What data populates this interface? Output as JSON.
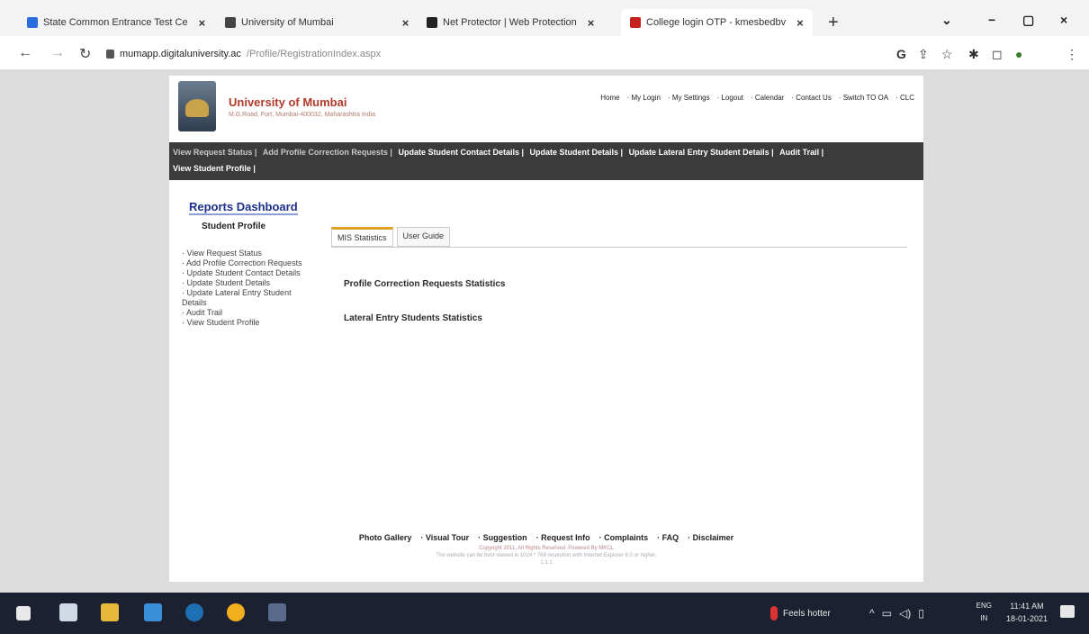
{
  "browser": {
    "tabs": [
      {
        "label": "State Common Entrance Test Ce",
        "color": "#2d6cdf"
      },
      {
        "label": "University of Mumbai",
        "color": "#444444"
      },
      {
        "label": "Net Protector | Web Protection",
        "color": "#222222"
      },
      {
        "label": "College login OTP - kmesbedbv",
        "color": "#c5221f"
      }
    ],
    "url_host": "mumapp.digitaluniversity.ac",
    "url_path": "/Profile/RegistrationIndex.aspx"
  },
  "site": {
    "title": "University of Mumbai",
    "subtitle": "M.G.Road, Fort, Mumbai-400032, Maharashtra India",
    "top_links": [
      "Home",
      "· My Login",
      "· My Settings",
      "· Logout",
      "· Calendar",
      "· Contact Us",
      "· Switch TO OA",
      "· CLC"
    ]
  },
  "menu": {
    "row1": [
      "View Request Status |",
      "Add Profile Correction Requests |",
      "Update Student Contact Details |",
      "Update Student Details |",
      "Update Lateral Entry Student Details |",
      "Audit Trail |"
    ],
    "row2": [
      "View Student Profile |"
    ]
  },
  "sidebar": {
    "dashboard_title": "Reports Dashboard",
    "heading": "Student Profile",
    "items": [
      "· View Request Status",
      "· Add Profile Correction Requests",
      "· Update Student Contact Details",
      "· Update Student Details",
      "· Update Lateral Entry Student Details",
      "· Audit Trail",
      "· View Student Profile"
    ]
  },
  "content": {
    "tabs": [
      "MIS Statistics",
      "User Guide"
    ],
    "sections": [
      "Profile Correction Requests Statistics",
      "Lateral Entry Students Statistics"
    ]
  },
  "footer": {
    "links": [
      "Photo Gallery",
      "· Visual Tour",
      "· Suggestion",
      "· Request Info",
      "· Complaints",
      "· FAQ",
      "· Disclaimer"
    ],
    "copyright": "Copyright 2011, All Rights Reserved. Powered By MKCL",
    "fine_print": "The website can be best viewed in 1024 * 768 resolution with Internet Explorer 6.0 or higher.",
    "fine_print_2": "1.1.1"
  },
  "taskbar": {
    "weather": "Feels hotter",
    "lang_top": "ENG",
    "lang_bottom": "IN",
    "time": "11:41 AM",
    "date": "18-01-2021"
  }
}
